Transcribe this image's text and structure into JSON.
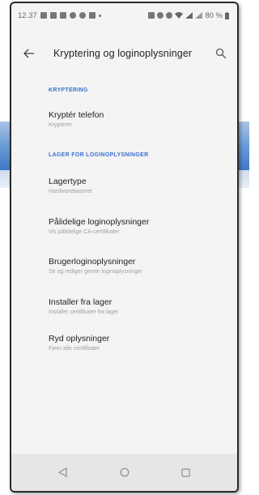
{
  "statusbar": {
    "time": "12.37",
    "battery": "80 %"
  },
  "toolbar": {
    "title": "Kryptering og loginoplysninger",
    "back_icon": "arrow-left-icon",
    "search_icon": "search-icon"
  },
  "sections": [
    {
      "header": "KRYPTERING",
      "items": [
        {
          "title": "Kryptér telefon",
          "summary": "Krypteret"
        }
      ]
    },
    {
      "header": "LAGER FOR LOGINOPLYSNINGER",
      "items": [
        {
          "title": "Lagertype",
          "summary": "Hardwarebaseret"
        },
        {
          "title": "Pålidelige loginoplysninger",
          "summary": "Vis pålidelige CA-certifikater"
        },
        {
          "title": "Brugerloginoplysninger",
          "summary": "Se og rediger gemte loginoplysninger"
        },
        {
          "title": "Installer fra lager",
          "summary": "Installer certifikater fra lager"
        },
        {
          "title": "Ryd oplysninger",
          "summary": "Fjern alle certifikater"
        }
      ]
    }
  ],
  "colors": {
    "accent": "#3b6fce",
    "background": "#f4f4f4",
    "navbar": "#e6e6e6"
  }
}
